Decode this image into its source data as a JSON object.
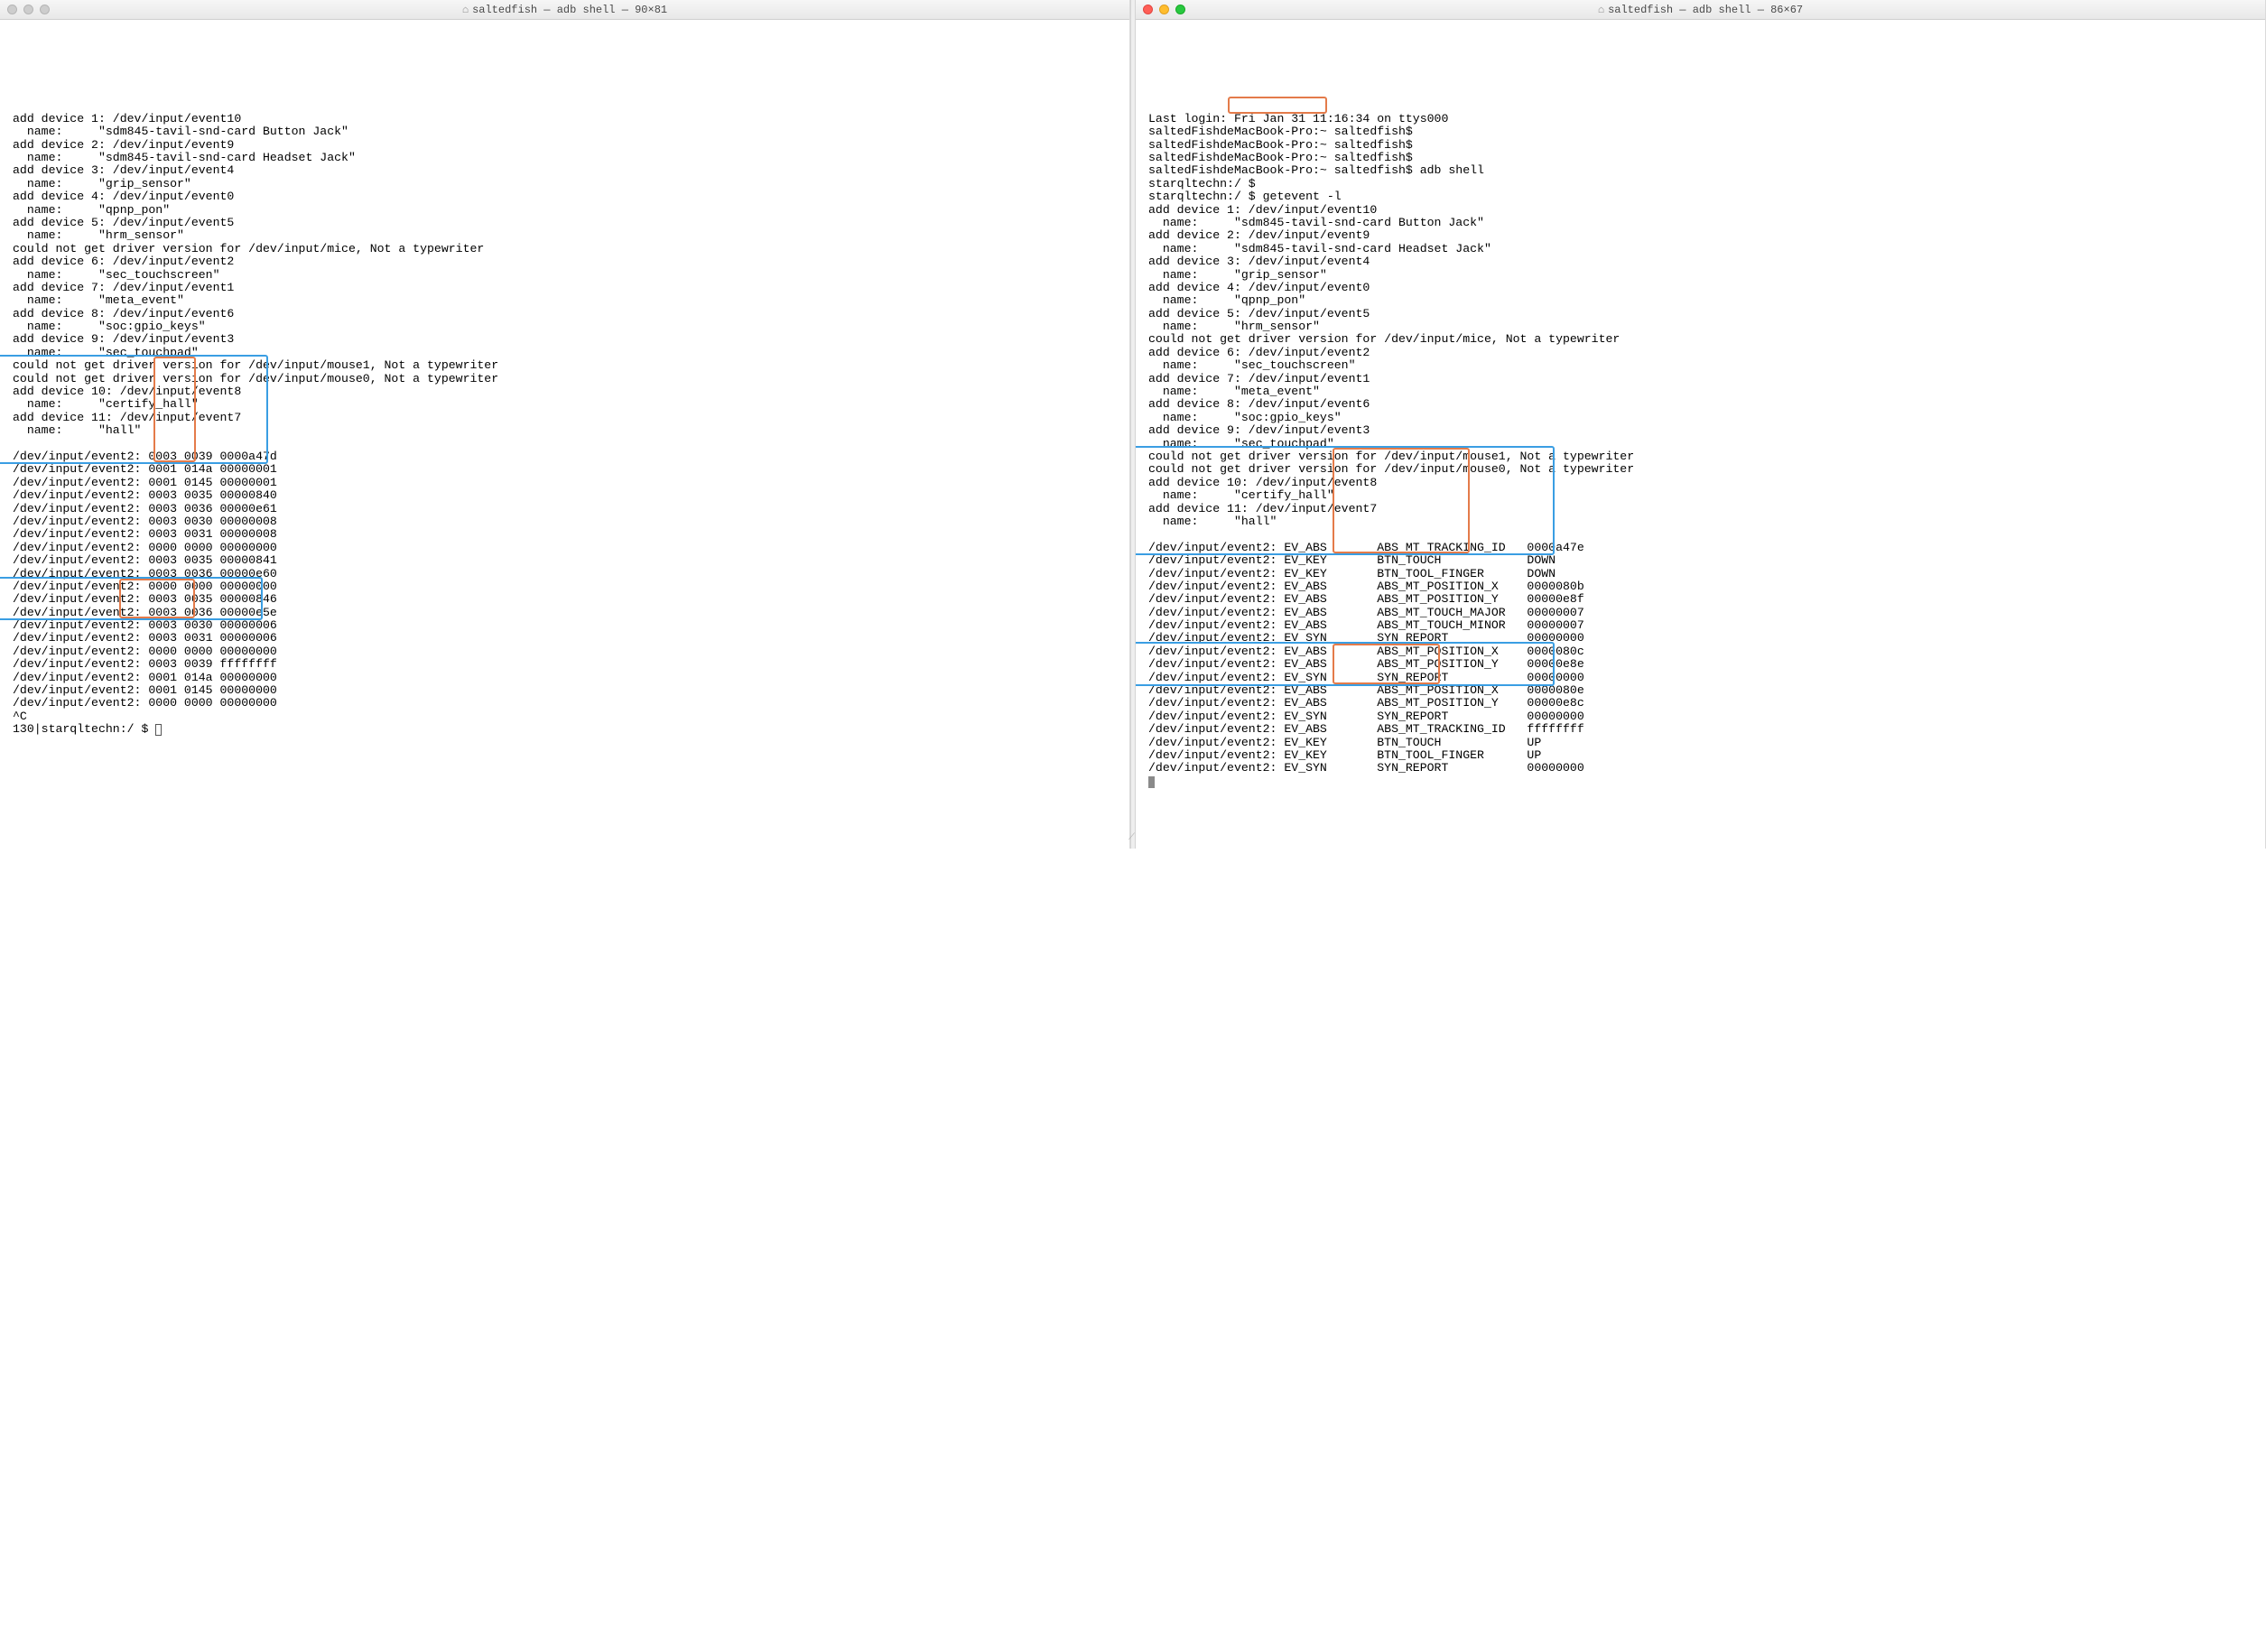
{
  "left": {
    "title_prefix": "saltedfish — adb shell — 90×81",
    "traffic_active": false,
    "lines": [
      "add device 1: /dev/input/event10",
      "  name:     \"sdm845-tavil-snd-card Button Jack\"",
      "add device 2: /dev/input/event9",
      "  name:     \"sdm845-tavil-snd-card Headset Jack\"",
      "add device 3: /dev/input/event4",
      "  name:     \"grip_sensor\"",
      "add device 4: /dev/input/event0",
      "  name:     \"qpnp_pon\"",
      "add device 5: /dev/input/event5",
      "  name:     \"hrm_sensor\"",
      "could not get driver version for /dev/input/mice, Not a typewriter",
      "add device 6: /dev/input/event2",
      "  name:     \"sec_touchscreen\"",
      "add device 7: /dev/input/event1",
      "  name:     \"meta_event\"",
      "add device 8: /dev/input/event6",
      "  name:     \"soc:gpio_keys\"",
      "add device 9: /dev/input/event3",
      "  name:     \"sec_touchpad\"",
      "could not get driver version for /dev/input/mouse1, Not a typewriter",
      "could not get driver version for /dev/input/mouse0, Not a typewriter",
      "add device 10: /dev/input/event8",
      "  name:     \"certify_hall\"",
      "add device 11: /dev/input/event7",
      "  name:     \"hall\"",
      "",
      "/dev/input/event2: 0003 0039 0000a47d",
      "/dev/input/event2: 0001 014a 00000001",
      "/dev/input/event2: 0001 0145 00000001",
      "/dev/input/event2: 0003 0035 00000840",
      "/dev/input/event2: 0003 0036 00000e61",
      "/dev/input/event2: 0003 0030 00000008",
      "/dev/input/event2: 0003 0031 00000008",
      "/dev/input/event2: 0000 0000 00000000",
      "/dev/input/event2: 0003 0035 00000841",
      "/dev/input/event2: 0003 0036 00000e60",
      "/dev/input/event2: 0000 0000 00000000",
      "/dev/input/event2: 0003 0035 00000846",
      "/dev/input/event2: 0003 0036 00000e5e",
      "/dev/input/event2: 0003 0030 00000006",
      "/dev/input/event2: 0003 0031 00000006",
      "/dev/input/event2: 0000 0000 00000000",
      "/dev/input/event2: 0003 0039 ffffffff",
      "/dev/input/event2: 0001 014a 00000000",
      "/dev/input/event2: 0001 0145 00000000",
      "/dev/input/event2: 0000 0000 00000000",
      "^C",
      "130|starqltechn:/ $ "
    ]
  },
  "right": {
    "title_prefix": "saltedfish — adb shell — 86×67",
    "traffic_active": true,
    "lines": [
      "Last login: Fri Jan 31 11:16:34 on ttys000",
      "saltedFishdeMacBook-Pro:~ saltedfish$",
      "saltedFishdeMacBook-Pro:~ saltedfish$",
      "saltedFishdeMacBook-Pro:~ saltedfish$",
      "saltedFishdeMacBook-Pro:~ saltedfish$ adb shell",
      "starqltechn:/ $",
      "starqltechn:/ $ getevent -l",
      "add device 1: /dev/input/event10",
      "  name:     \"sdm845-tavil-snd-card Button Jack\"",
      "add device 2: /dev/input/event9",
      "  name:     \"sdm845-tavil-snd-card Headset Jack\"",
      "add device 3: /dev/input/event4",
      "  name:     \"grip_sensor\"",
      "add device 4: /dev/input/event0",
      "  name:     \"qpnp_pon\"",
      "add device 5: /dev/input/event5",
      "  name:     \"hrm_sensor\"",
      "could not get driver version for /dev/input/mice, Not a typewriter",
      "add device 6: /dev/input/event2",
      "  name:     \"sec_touchscreen\"",
      "add device 7: /dev/input/event1",
      "  name:     \"meta_event\"",
      "add device 8: /dev/input/event6",
      "  name:     \"soc:gpio_keys\"",
      "add device 9: /dev/input/event3",
      "  name:     \"sec_touchpad\"",
      "could not get driver version for /dev/input/mouse1, Not a typewriter",
      "could not get driver version for /dev/input/mouse0, Not a typewriter",
      "add device 10: /dev/input/event8",
      "  name:     \"certify_hall\"",
      "add device 11: /dev/input/event7",
      "  name:     \"hall\"",
      "",
      "/dev/input/event2: EV_ABS       ABS_MT_TRACKING_ID   0000a47e",
      "/dev/input/event2: EV_KEY       BTN_TOUCH            DOWN",
      "/dev/input/event2: EV_KEY       BTN_TOOL_FINGER      DOWN",
      "/dev/input/event2: EV_ABS       ABS_MT_POSITION_X    0000080b",
      "/dev/input/event2: EV_ABS       ABS_MT_POSITION_Y    00000e8f",
      "/dev/input/event2: EV_ABS       ABS_MT_TOUCH_MAJOR   00000007",
      "/dev/input/event2: EV_ABS       ABS_MT_TOUCH_MINOR   00000007",
      "/dev/input/event2: EV_SYN       SYN_REPORT           00000000",
      "/dev/input/event2: EV_ABS       ABS_MT_POSITION_X    0000080c",
      "/dev/input/event2: EV_ABS       ABS_MT_POSITION_Y    00000e8e",
      "/dev/input/event2: EV_SYN       SYN_REPORT           00000000",
      "/dev/input/event2: EV_ABS       ABS_MT_POSITION_X    0000080e",
      "/dev/input/event2: EV_ABS       ABS_MT_POSITION_Y    00000e8c",
      "/dev/input/event2: EV_SYN       SYN_REPORT           00000000",
      "/dev/input/event2: EV_ABS       ABS_MT_TRACKING_ID   ffffffff",
      "/dev/input/event2: EV_KEY       BTN_TOUCH            UP",
      "/dev/input/event2: EV_KEY       BTN_TOOL_FINGER      UP",
      "/dev/input/event2: EV_SYN       SYN_REPORT           00000000"
    ]
  },
  "watermark": ""
}
